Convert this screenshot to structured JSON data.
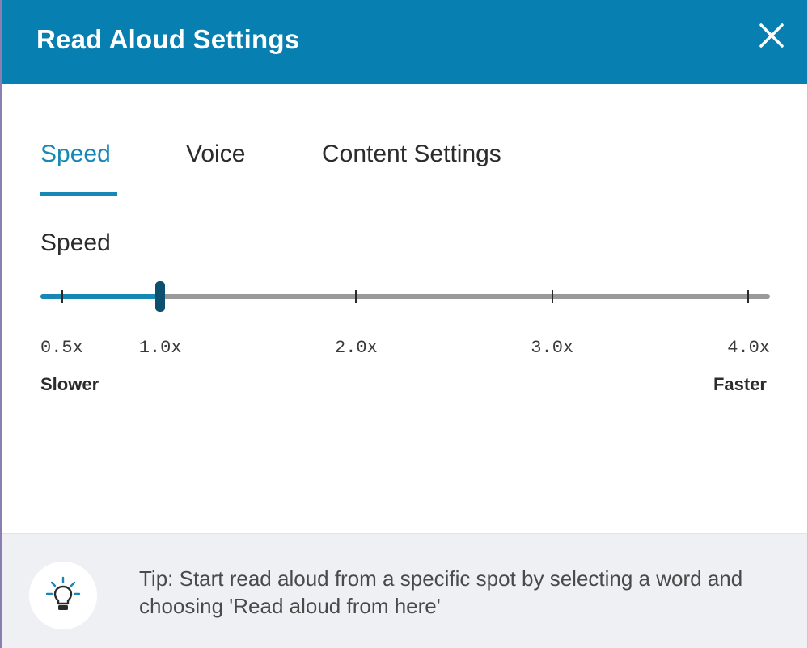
{
  "dialog": {
    "title": "Read Aloud Settings",
    "close_icon": "close-icon"
  },
  "tabs": [
    {
      "label": "Speed",
      "active": true
    },
    {
      "label": "Voice",
      "active": false
    },
    {
      "label": "Content Settings",
      "active": false
    }
  ],
  "speed": {
    "section_label": "Speed",
    "min": 0.5,
    "max": 4.0,
    "value": 1.0,
    "ticks": [
      {
        "value": 0.5,
        "label": "0.5x"
      },
      {
        "value": 1.0,
        "label": "1.0x"
      },
      {
        "value": 2.0,
        "label": "2.0x"
      },
      {
        "value": 3.0,
        "label": "3.0x"
      },
      {
        "value": 4.0,
        "label": "4.0x"
      }
    ],
    "min_caption": "Slower",
    "max_caption": "Faster"
  },
  "tip": {
    "icon": "lightbulb-icon",
    "text": "Tip: Start read aloud from a specific spot by selecting a word and choosing 'Read aloud from here'"
  },
  "colors": {
    "header_bg": "#0780b1",
    "accent": "#1788b5",
    "thumb": "#0c4f6e",
    "track": "#9a9a9a",
    "footer_bg": "#eef0f4"
  }
}
